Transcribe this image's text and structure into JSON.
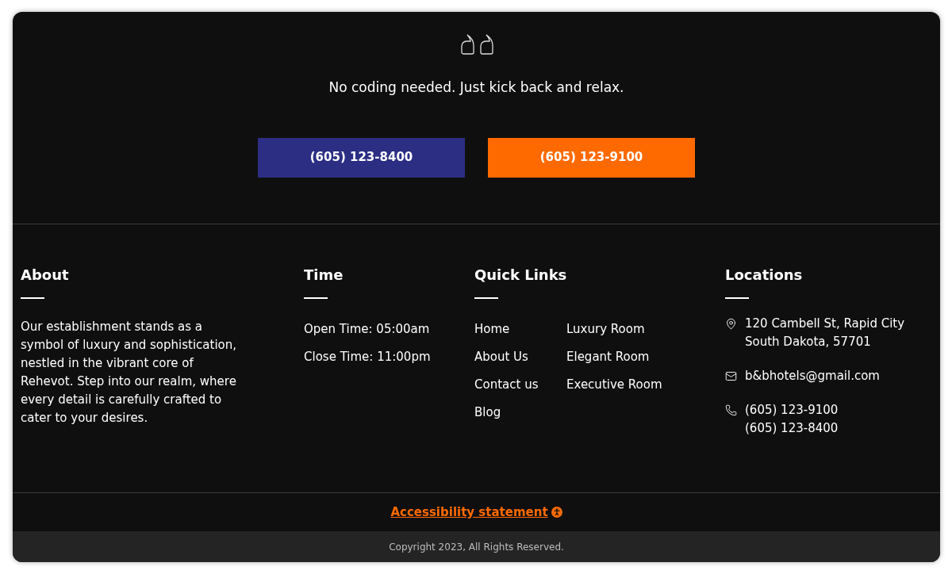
{
  "quote": {
    "text": "No coding needed. Just kick back and relax."
  },
  "call_buttons": [
    {
      "label": "(605) 123-8400",
      "color": "#2b2e83"
    },
    {
      "label": "(605) 123-9100",
      "color": "#ff6a00"
    }
  ],
  "about": {
    "heading": "About",
    "text": "Our establishment stands as a symbol of luxury and sophistication, nestled in the vibrant core of Rehevot. Step into our realm, where every detail is carefully crafted to cater to your desires."
  },
  "time": {
    "heading": "Time",
    "lines": [
      "Open Time: 05:00am",
      "Close Time: 11:00pm"
    ]
  },
  "quick_links": {
    "heading": "Quick Links",
    "columns": [
      [
        "Home",
        "About Us",
        "Contact us",
        "Blog"
      ],
      [
        "Luxury Room",
        "Elegant Room",
        "Executive Room"
      ]
    ]
  },
  "locations": {
    "heading": "Locations",
    "items": [
      {
        "kind": "address",
        "lines": [
          "120 Cambell St, Rapid City",
          "South Dakota, 57701"
        ]
      },
      {
        "kind": "email",
        "lines": [
          "b&bhotels@gmail.com"
        ]
      },
      {
        "kind": "phone",
        "lines": [
          "(605) 123-9100",
          "(605) 123-8400"
        ]
      }
    ]
  },
  "accessibility_link": "Accessibility statement",
  "copyright": "Copyright 2023, All Rights Reserved."
}
